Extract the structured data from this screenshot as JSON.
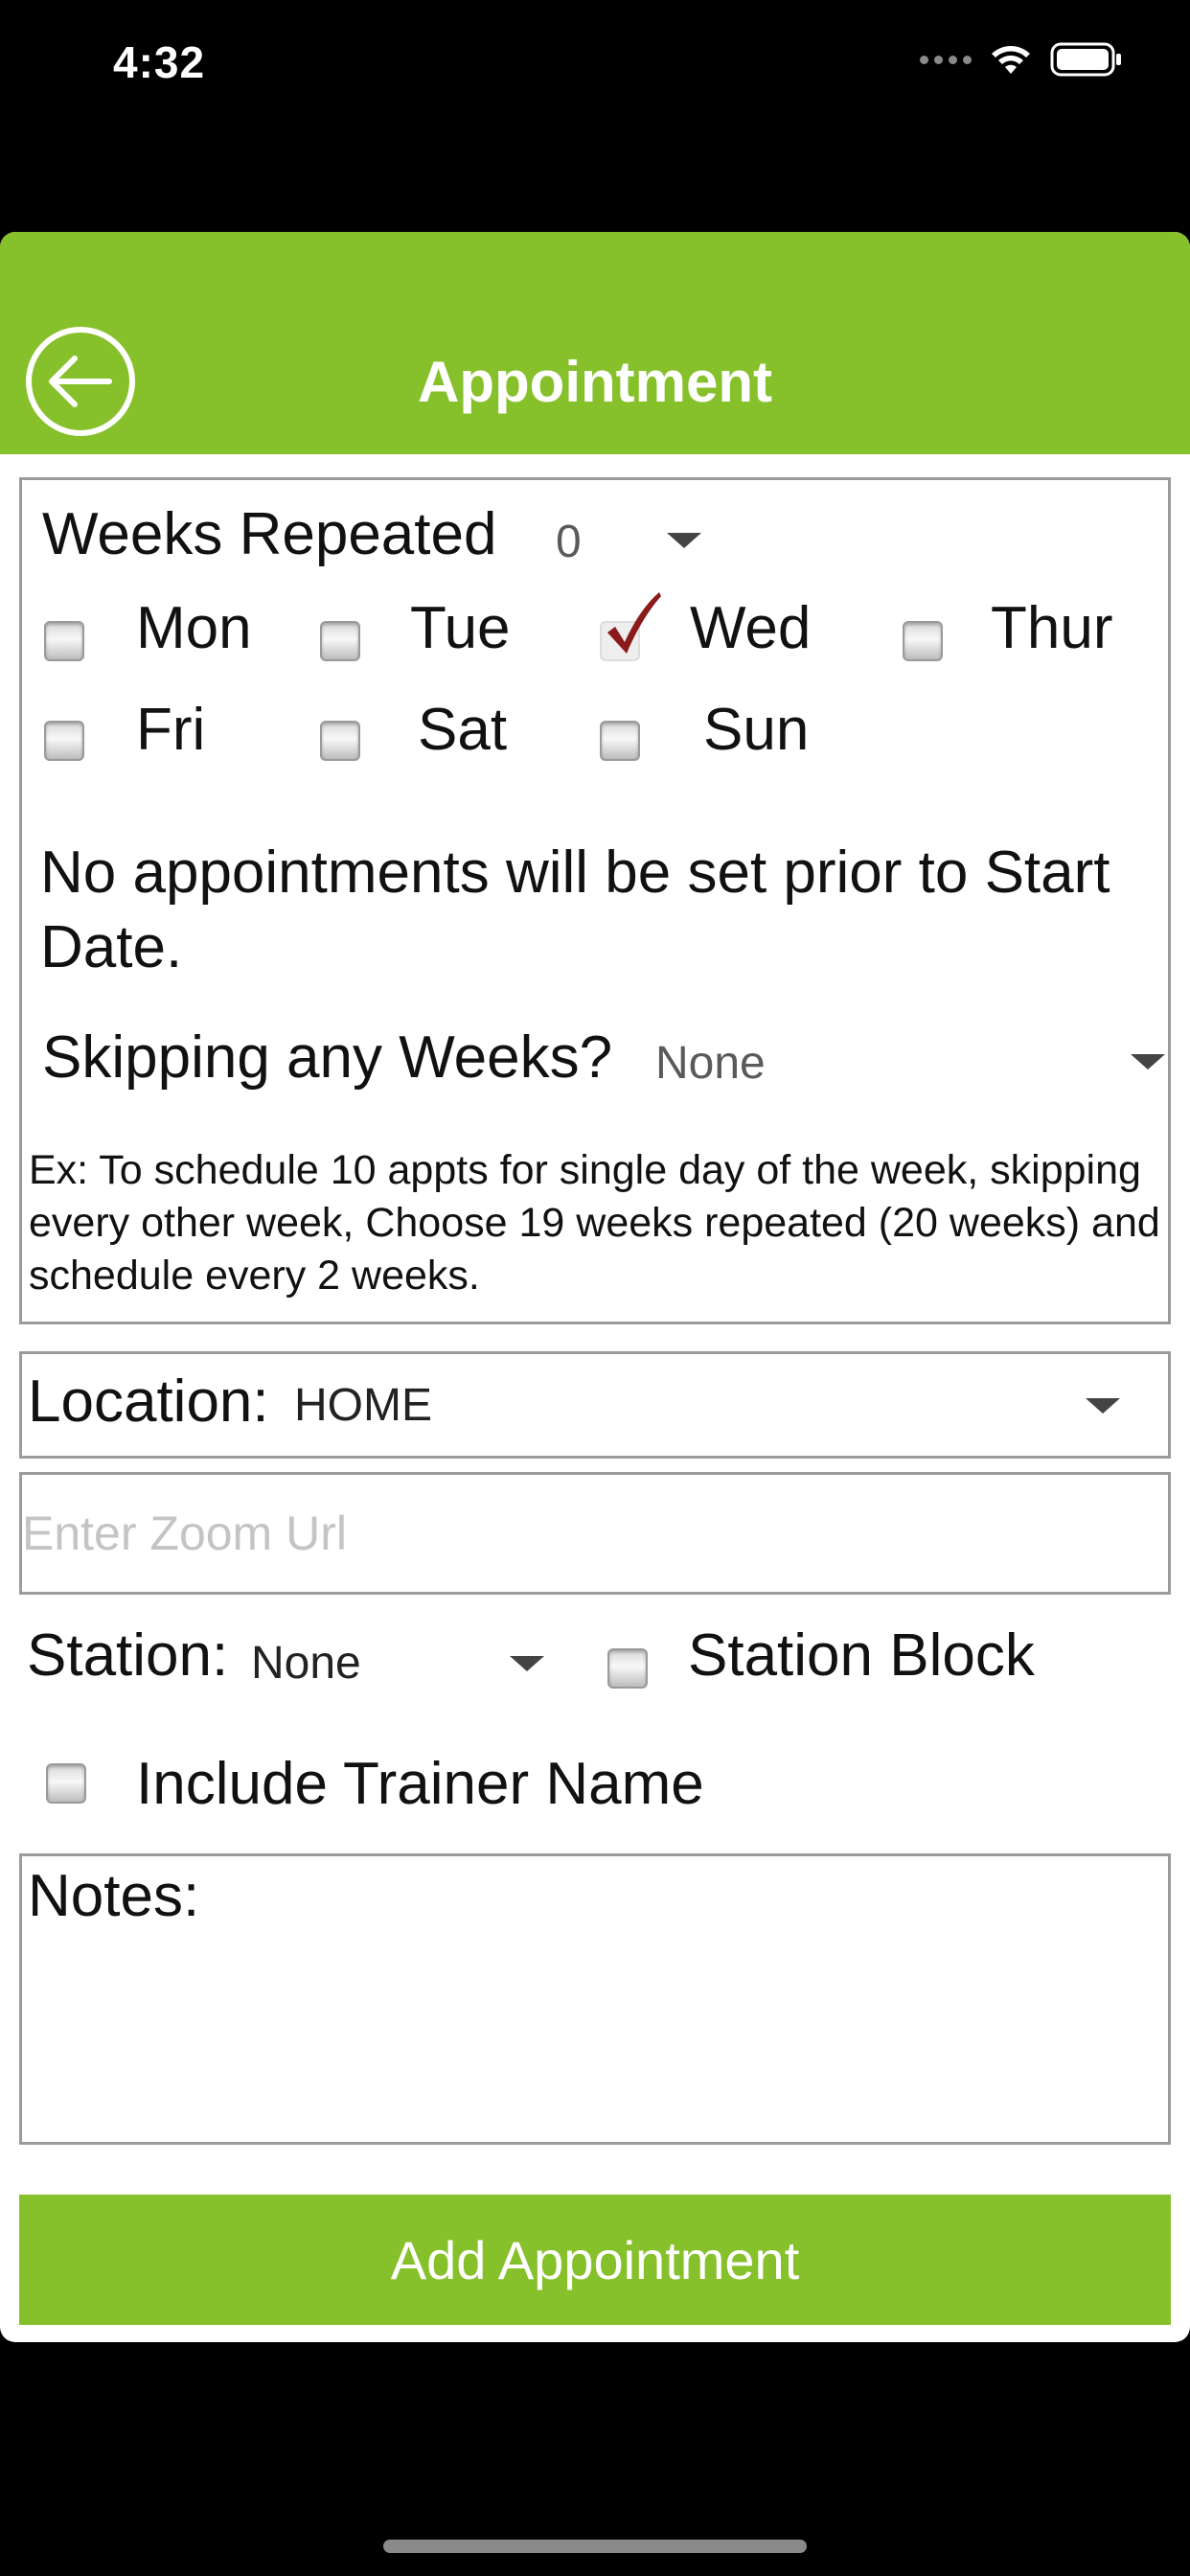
{
  "status_bar": {
    "time": "4:32"
  },
  "header": {
    "title": "Appointment",
    "back_icon": "arrow-left-circle-icon"
  },
  "repeat": {
    "weeks_label": "Weeks Repeated",
    "weeks_value": "0",
    "days": [
      {
        "label": "Mon",
        "checked": false
      },
      {
        "label": "Tue",
        "checked": false
      },
      {
        "label": "Wed",
        "checked": true
      },
      {
        "label": "Thur",
        "checked": false
      },
      {
        "label": "Fri",
        "checked": false
      },
      {
        "label": "Sat",
        "checked": false
      },
      {
        "label": "Sun",
        "checked": false
      }
    ],
    "note": "No appointments will be set prior to Start Date.",
    "skip_label": "Skipping any Weeks?",
    "skip_value": "None",
    "example": "Ex: To schedule 10 appts for  single day of the week, skipping every other week, Choose 19 weeks repeated (20 weeks) and schedule every 2 weeks."
  },
  "location": {
    "label": "Location:",
    "value": "HOME"
  },
  "zoom": {
    "placeholder": "Enter Zoom Url",
    "value": ""
  },
  "station": {
    "label": "Station:",
    "value": "None",
    "block_label": "Station Block",
    "block_checked": false
  },
  "trainer": {
    "label": "Include Trainer Name",
    "checked": false
  },
  "notes": {
    "label": "Notes:"
  },
  "submit": {
    "label": "Add Appointment"
  },
  "colors": {
    "accent": "#86c12c",
    "check_mark": "#8b1a1a",
    "border": "#9b9b9b"
  }
}
